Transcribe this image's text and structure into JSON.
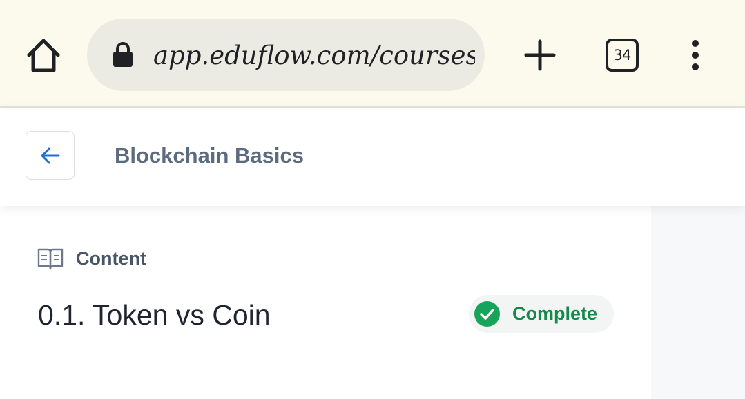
{
  "browser": {
    "url": "app.eduflow.com/courses/",
    "tab_count": "34",
    "icons": {
      "home": "home-icon",
      "lock": "lock-icon",
      "new_tab": "plus-icon",
      "tabs": "tab-switcher-icon",
      "menu": "kebab-menu-icon"
    }
  },
  "header": {
    "back_icon": "arrow-left-icon",
    "course_title": "Blockchain Basics"
  },
  "content": {
    "section_icon": "book-icon",
    "section_label": "Content",
    "lesson_title": "0.1. Token vs Coin",
    "status": {
      "label": "Complete",
      "icon": "check-circle-icon",
      "color": "#16a35a"
    }
  },
  "colors": {
    "browser_bar": "#fbfaec",
    "accent_blue": "#1f6fd1",
    "status_green": "#16a35a"
  }
}
